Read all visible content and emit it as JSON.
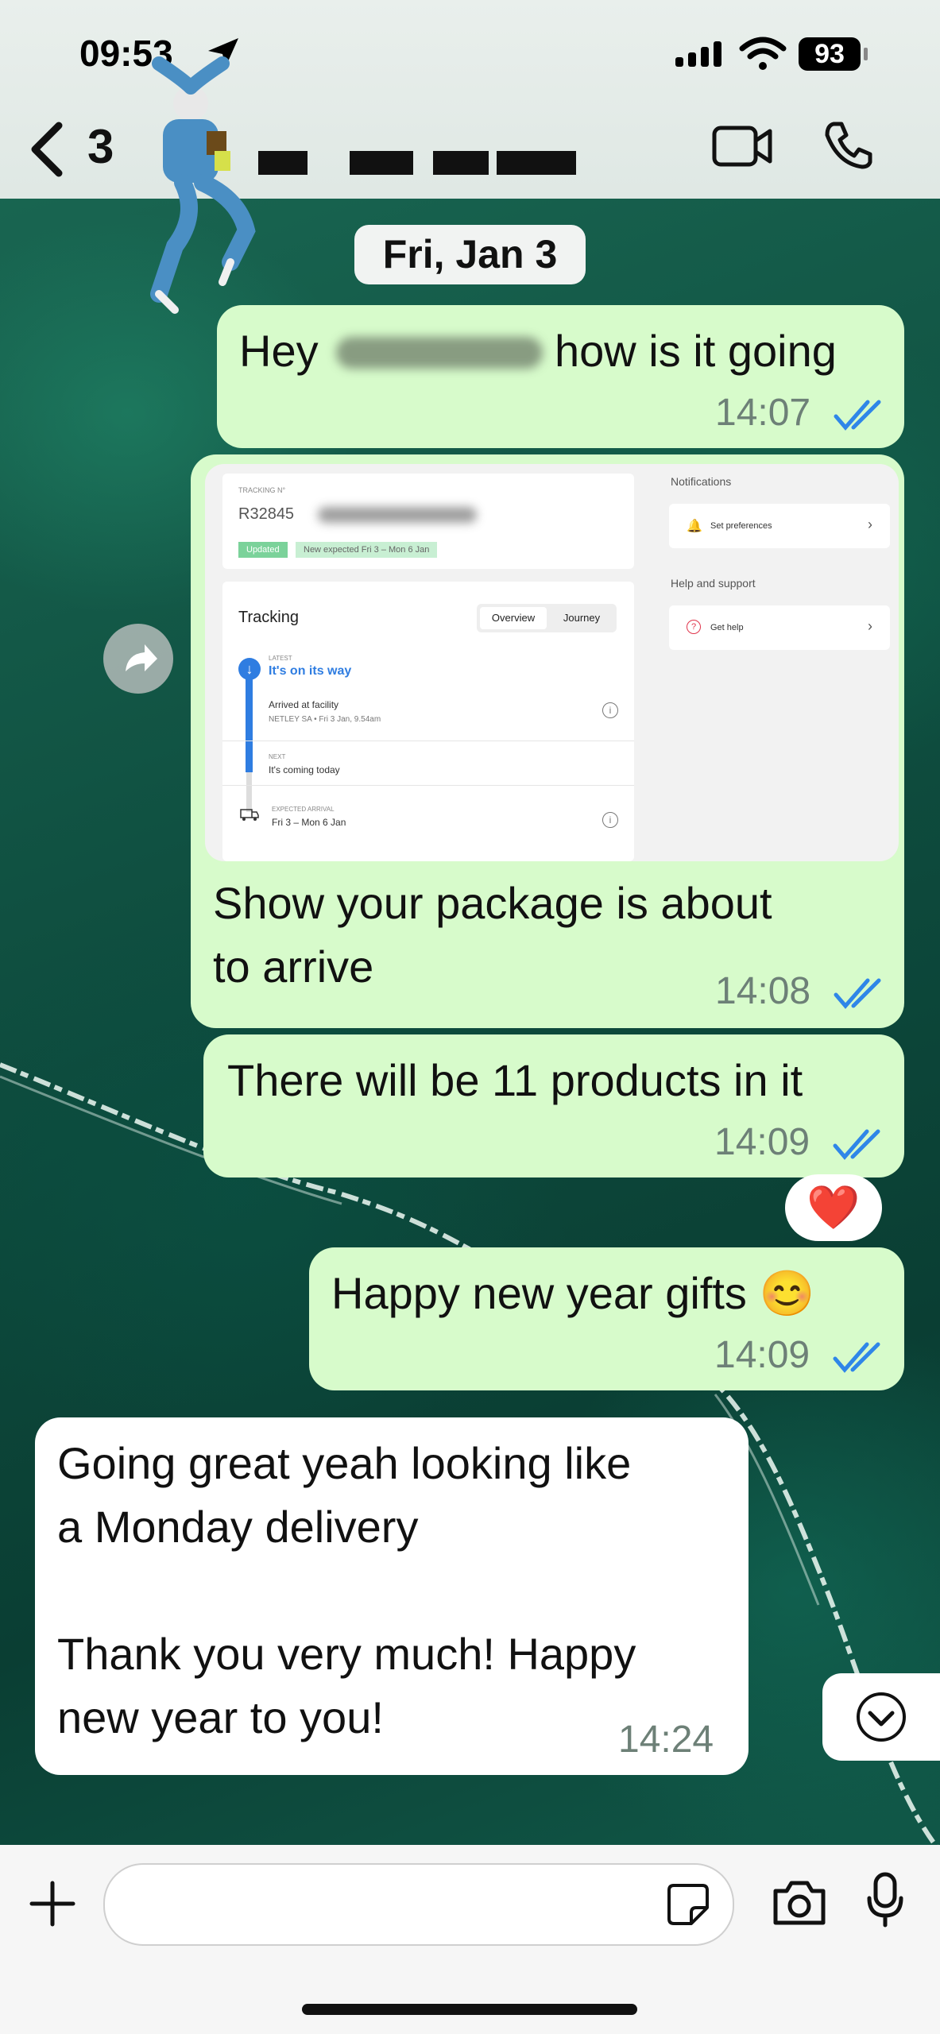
{
  "status": {
    "time": "09:53",
    "battery": "93"
  },
  "header": {
    "contact_visible": "3"
  },
  "date_separator": "Fri, Jan 3",
  "messages": [
    {
      "dir": "out",
      "text_start": "Hey",
      "text_end": "how is it going",
      "time": "14:07"
    },
    {
      "dir": "out",
      "text_line1": "Show your package is about",
      "text_line2": "to arrive",
      "time": "14:08"
    },
    {
      "dir": "out",
      "text": "There will be 11 products in it",
      "time": "14:09"
    },
    {
      "dir": "out",
      "text": "Happy new year gifts 😊",
      "time": "14:09",
      "reaction": "❤️"
    },
    {
      "dir": "in",
      "line1": "Going great yeah looking like",
      "line2": "a Monday delivery",
      "line3": "Thank you very much! Happy",
      "line4": "new year to you!",
      "time": "14:24"
    }
  ],
  "screenshot": {
    "tracking_label": "TRACKING N°",
    "tracking_number": "R32845",
    "updated_badge": "Updated",
    "new_expected": "New expected Fri 3 – Mon 6 Jan",
    "tracking_title": "Tracking",
    "tab_overview": "Overview",
    "tab_journey": "Journey",
    "latest_label": "LATEST",
    "latest_status": "It's on its way",
    "arrived": "Arrived at facility",
    "arrived_detail": "NETLEY SA • Fri 3 Jan, 9.54am",
    "next_label": "NEXT",
    "next_status": "It's coming today",
    "expected_label": "EXPECTED ARRIVAL",
    "expected_value": "Fri 3 – Mon 6 Jan",
    "notifications_title": "Notifications",
    "set_preferences": "Set preferences",
    "help_title": "Help and support",
    "get_help": "Get help"
  },
  "colors": {
    "bubble_out": "#d7fbcb",
    "bubble_in": "#ffffff",
    "tick_blue": "#2f86e8",
    "accent_blue": "#2f7de1"
  }
}
